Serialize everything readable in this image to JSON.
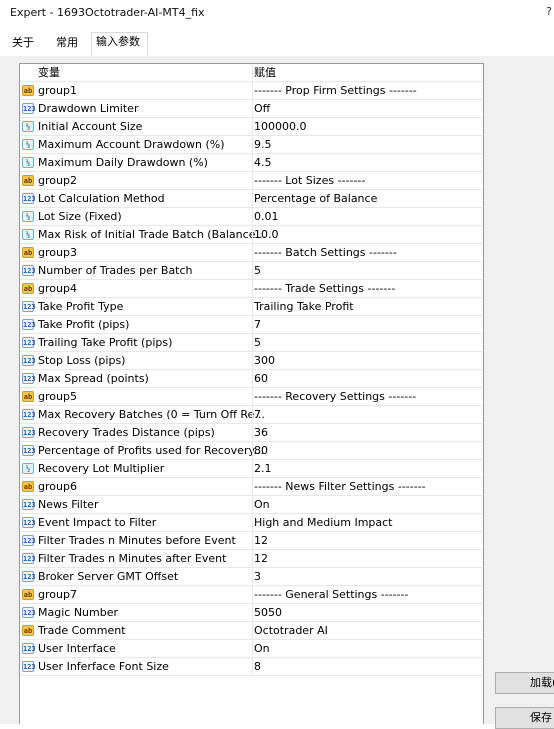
{
  "window": {
    "title": "Expert - 1693Octotrader-AI-MT4_fix",
    "corner_glyph": "?"
  },
  "tabs": [
    {
      "label": "关于",
      "active": false
    },
    {
      "label": "常用",
      "active": false
    },
    {
      "label": "输入参数",
      "active": true
    }
  ],
  "grid": {
    "headers": {
      "variable": "变量",
      "value": "赋值"
    },
    "rows": [
      {
        "type": "ab",
        "icon": "string-type-icon",
        "name": "group1",
        "value": "------- Prop Firm Settings -------"
      },
      {
        "type": "int",
        "icon": "integer-type-icon",
        "name": "Drawdown Limiter",
        "value": "Off"
      },
      {
        "type": "dbl",
        "icon": "double-type-icon",
        "name": "Initial Account Size",
        "value": "100000.0"
      },
      {
        "type": "dbl",
        "icon": "double-type-icon",
        "name": "Maximum Account Drawdown (%)",
        "value": "9.5"
      },
      {
        "type": "dbl",
        "icon": "double-type-icon",
        "name": "Maximum Daily Drawdown (%)",
        "value": "4.5"
      },
      {
        "type": "ab",
        "icon": "string-type-icon",
        "name": "group2",
        "value": "------- Lot Sizes -------"
      },
      {
        "type": "int",
        "icon": "integer-type-icon",
        "name": "Lot Calculation Method",
        "value": "Percentage of Balance"
      },
      {
        "type": "dbl",
        "icon": "double-type-icon",
        "name": "Lot Size (Fixed)",
        "value": "0.01"
      },
      {
        "type": "dbl",
        "icon": "double-type-icon",
        "name": "Max Risk of Initial Trade Batch (Balance...",
        "value": "10.0"
      },
      {
        "type": "ab",
        "icon": "string-type-icon",
        "name": "group3",
        "value": "------- Batch Settings -------"
      },
      {
        "type": "int",
        "icon": "integer-type-icon",
        "name": "Number of Trades per Batch",
        "value": "5"
      },
      {
        "type": "ab",
        "icon": "string-type-icon",
        "name": "group4",
        "value": "------- Trade Settings -------"
      },
      {
        "type": "int",
        "icon": "integer-type-icon",
        "name": "Take Profit Type",
        "value": "Trailing Take Profit"
      },
      {
        "type": "int",
        "icon": "integer-type-icon",
        "name": "Take Profit (pips)",
        "value": "7"
      },
      {
        "type": "int",
        "icon": "integer-type-icon",
        "name": "Trailing Take Profit (pips)",
        "value": "5"
      },
      {
        "type": "int",
        "icon": "integer-type-icon",
        "name": "Stop Loss (pips)",
        "value": "300"
      },
      {
        "type": "int",
        "icon": "integer-type-icon",
        "name": "Max Spread (points)",
        "value": "60"
      },
      {
        "type": "ab",
        "icon": "string-type-icon",
        "name": "group5",
        "value": "------- Recovery Settings -------"
      },
      {
        "type": "int",
        "icon": "integer-type-icon",
        "name": "Max Recovery Batches (0 = Turn Off Re...",
        "value": "7"
      },
      {
        "type": "int",
        "icon": "integer-type-icon",
        "name": "Recovery Trades Distance (pips)",
        "value": "36"
      },
      {
        "type": "int",
        "icon": "integer-type-icon",
        "name": "Percentage of Profits used for Recovery...",
        "value": "80"
      },
      {
        "type": "dbl",
        "icon": "double-type-icon",
        "name": "Recovery Lot Multiplier",
        "value": "2.1"
      },
      {
        "type": "ab",
        "icon": "string-type-icon",
        "name": "group6",
        "value": "------- News Filter Settings -------"
      },
      {
        "type": "int",
        "icon": "integer-type-icon",
        "name": "News Filter",
        "value": "On"
      },
      {
        "type": "int",
        "icon": "integer-type-icon",
        "name": "Event Impact to Filter",
        "value": "High and Medium Impact"
      },
      {
        "type": "int",
        "icon": "integer-type-icon",
        "name": "Filter Trades n Minutes before Event",
        "value": "12"
      },
      {
        "type": "int",
        "icon": "integer-type-icon",
        "name": "Filter Trades n Minutes after Event",
        "value": "12"
      },
      {
        "type": "int",
        "icon": "integer-type-icon",
        "name": "Broker Server GMT Offset",
        "value": "3"
      },
      {
        "type": "ab",
        "icon": "string-type-icon",
        "name": "group7",
        "value": "------- General Settings -------"
      },
      {
        "type": "int",
        "icon": "integer-type-icon",
        "name": "Magic Number",
        "value": "5050"
      },
      {
        "type": "ab",
        "icon": "string-type-icon",
        "name": "Trade Comment",
        "value": "Octotrader AI"
      },
      {
        "type": "int",
        "icon": "integer-type-icon",
        "name": "User Interface",
        "value": "On"
      },
      {
        "type": "int",
        "icon": "integer-type-icon",
        "name": "User Inferface Font Size",
        "value": "8"
      }
    ]
  },
  "buttons": {
    "load": "加载(",
    "save": "保存"
  },
  "icon_glyphs": {
    "ab": "ab",
    "int": "123",
    "dbl": "½"
  }
}
